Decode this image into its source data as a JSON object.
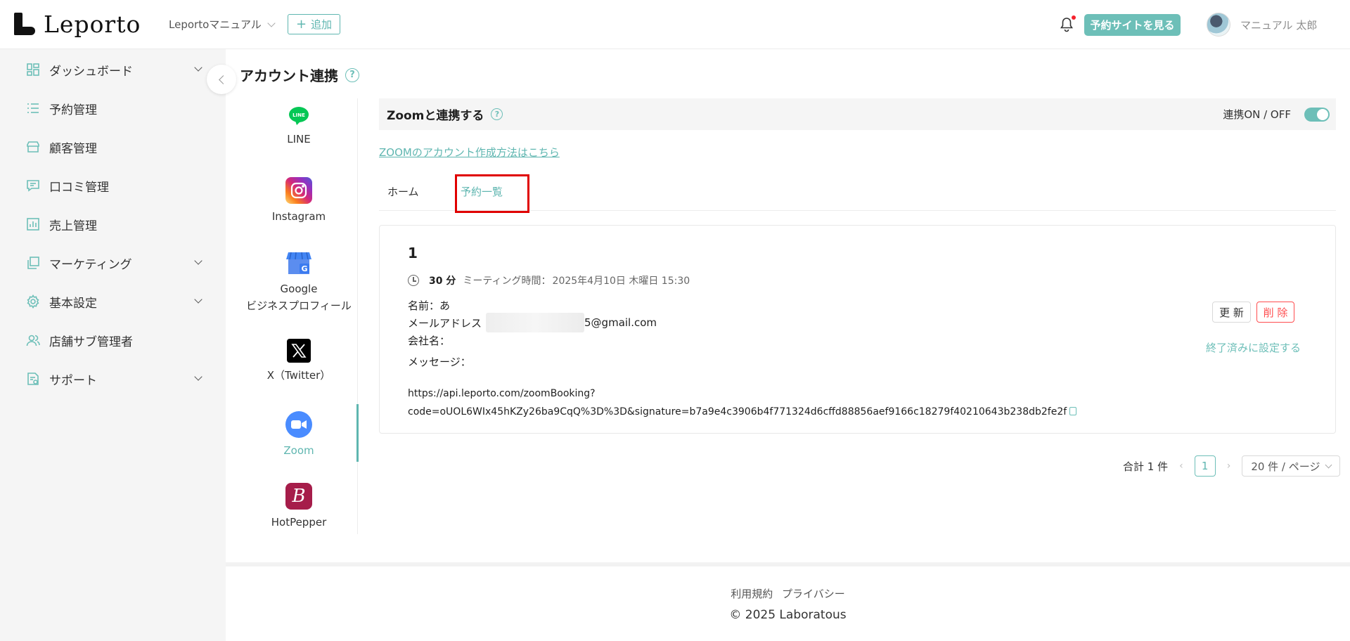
{
  "header": {
    "logo_text": "Leporto",
    "store_name": "Leportoマニュアル",
    "add_label": "追加",
    "view_site_label": "予約サイトを見る",
    "user_name": "マニュアル 太郎"
  },
  "sidebar": {
    "items": [
      {
        "label": "ダッシュボード"
      },
      {
        "label": "予約管理"
      },
      {
        "label": "顧客管理"
      },
      {
        "label": "口コミ管理"
      },
      {
        "label": "売上管理"
      },
      {
        "label": "マーケティング"
      },
      {
        "label": "基本設定"
      },
      {
        "label": "店舗サブ管理者"
      },
      {
        "label": "サポート"
      }
    ]
  },
  "page": {
    "title": "アカウント連携",
    "help_glyph": "?"
  },
  "services": [
    {
      "name": "LINE"
    },
    {
      "name": "Instagram"
    },
    {
      "name": "Google",
      "name2": "ビジネスプロフィール"
    },
    {
      "name": "X（Twitter）"
    },
    {
      "name": "Zoom"
    },
    {
      "name": "HotPepper"
    }
  ],
  "zoom_panel": {
    "title": "Zoomと連携する",
    "toggle_label": "連携ON / OFF",
    "toggle_on": true,
    "account_link": "ZOOMのアカウント作成方法はこちら",
    "tabs": {
      "home": "ホーム",
      "bookings": "予約一覧"
    }
  },
  "booking": {
    "number": "1",
    "duration": "30 分",
    "meeting_label": "ミーティング時間：",
    "meeting_time": "2025年4月10日 木曜日 15:30",
    "name_label": "名前：",
    "name_value": "あ",
    "email_label": "メールアドレス",
    "email_visible": "5@gmail.com",
    "company_label": "会社名：",
    "message_label": "メッセージ：",
    "url_line1": "https://api.leporto.com/zoomBooking?",
    "url_line2": "code=oUOL6WIx45hKZy26ba9CqQ%3D%3D&signature=b7a9e4c3906b4f771324d6cffd88856aef9166c18279f40210643b238db2fe2f",
    "update_label": "更 新",
    "delete_label": "削 除",
    "set_done_label": "終了済みに設定する"
  },
  "pagination": {
    "total": "合計 1 件",
    "current_page": "1",
    "page_size": "20 件 / ページ"
  },
  "footer": {
    "terms": "利用規約",
    "privacy": "プライバシー",
    "copyright": "© 2025 Laboratous"
  },
  "colors": {
    "accent": "#6dbfb8",
    "danger": "#ff4d4f",
    "highlight": "#e00000"
  }
}
